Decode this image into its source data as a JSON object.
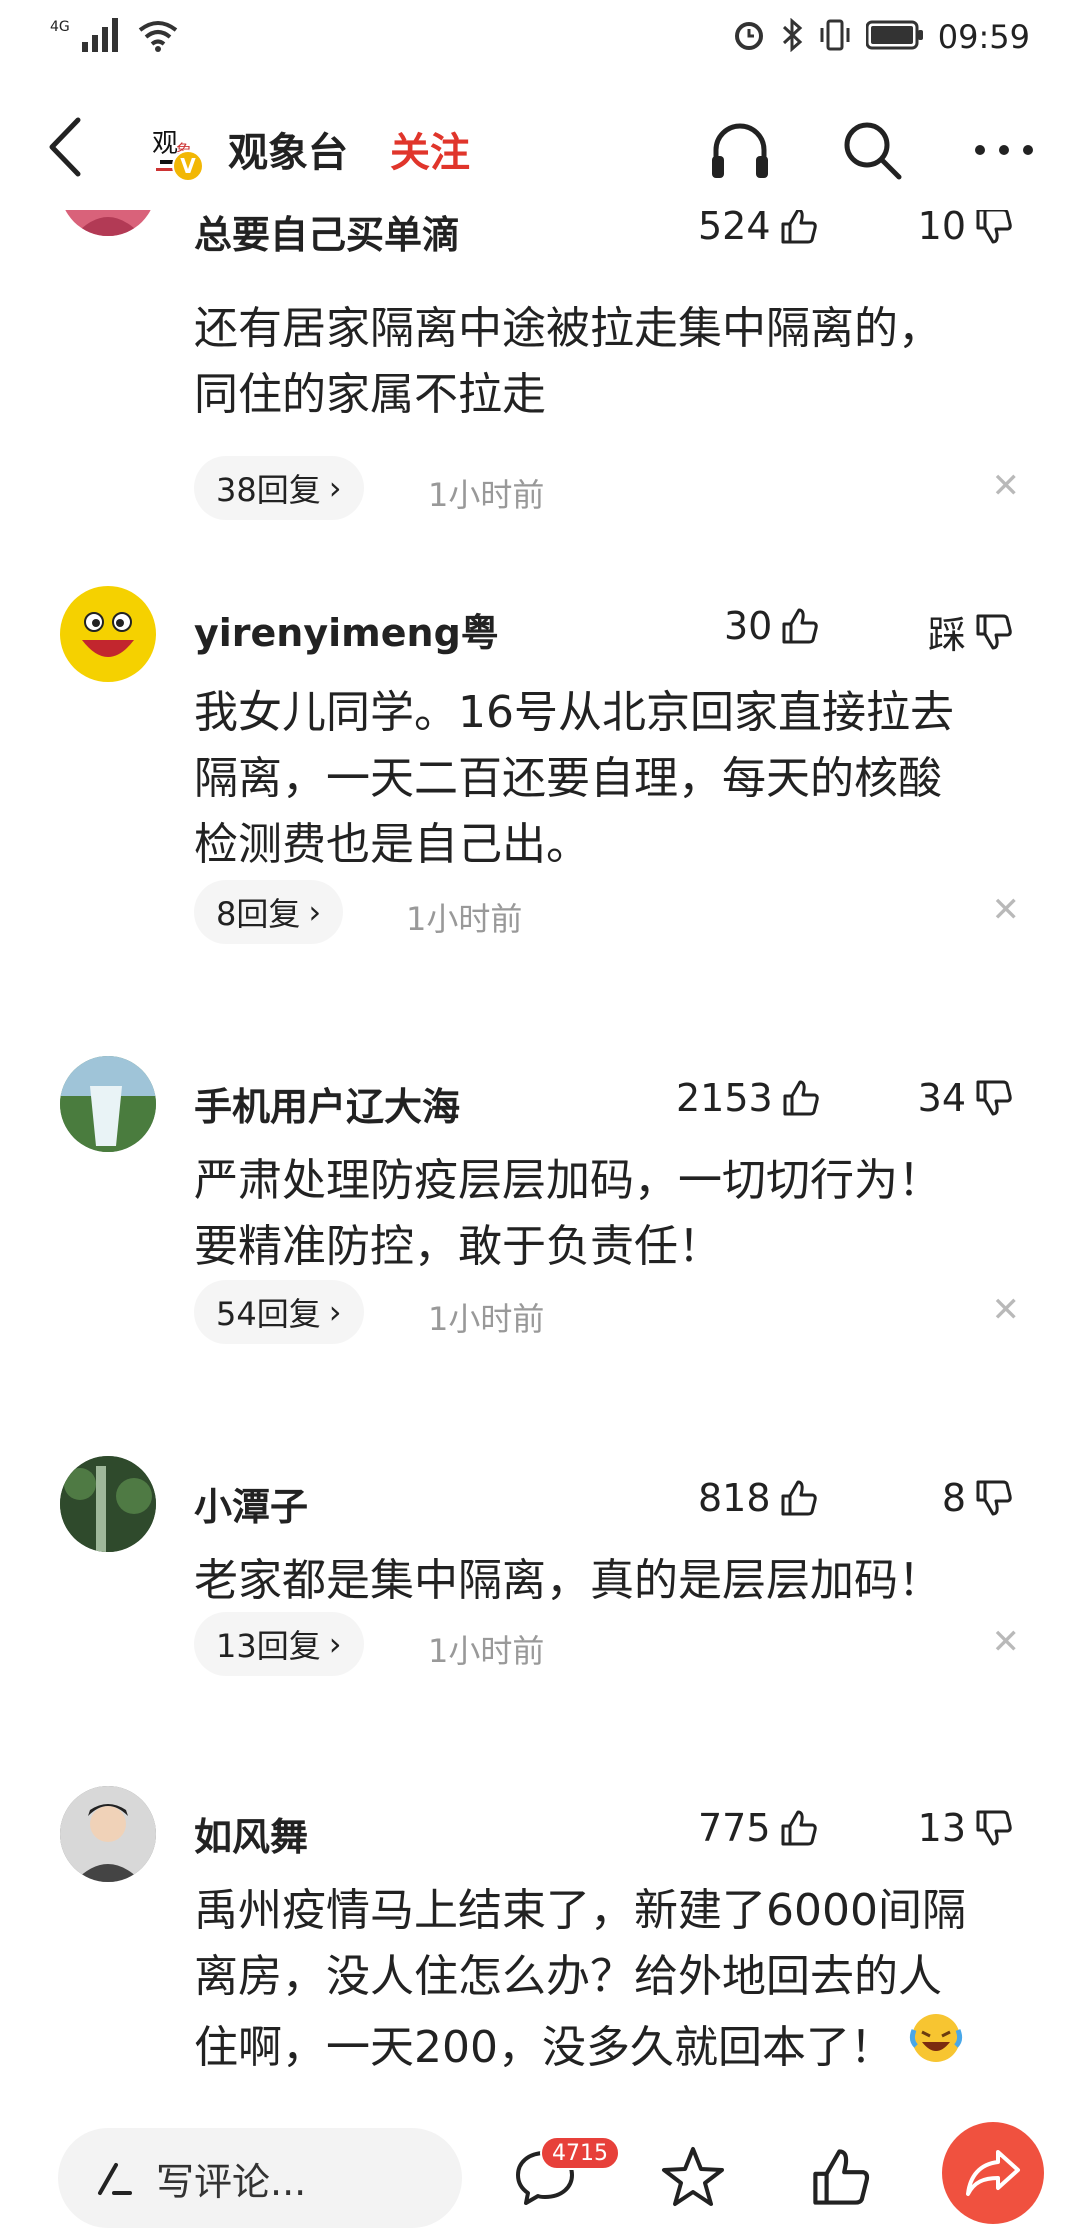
{
  "status_bar": {
    "network": "4G",
    "time": "09:59"
  },
  "header": {
    "channel_name": "观象台",
    "follow_label": "关注",
    "verified_badge": "V"
  },
  "comments": [
    {
      "name": "总要自己买单滴",
      "likes": "524",
      "dislikes": "10",
      "text_lines": [
        "还有居家隔离中途被拉走集中隔离的，",
        "同住的家属不拉走"
      ],
      "replies": "38回复",
      "time": "1小时前",
      "avatar_color": "#d9627a"
    },
    {
      "name": "yirenyimeng粤",
      "likes": "30",
      "dislikes": "踩",
      "text_lines": [
        "我女儿同学。16号从北京回家直接拉去",
        "隔离，一天二百还要自理，每天的核酸",
        "检测费也是自己出。"
      ],
      "replies": "8回复",
      "time": "1小时前",
      "avatar_color": "#f5d100"
    },
    {
      "name": "手机用户辽大海",
      "likes": "2153",
      "dislikes": "34",
      "text_lines": [
        "严肃处理防疫层层加码，一切切行为！",
        "要精准防控，敢于负责任！"
      ],
      "replies": "54回复",
      "time": "1小时前",
      "avatar_color": "#5e8a57"
    },
    {
      "name": "小潭子",
      "likes": "818",
      "dislikes": "8",
      "text_lines": [
        "老家都是集中隔离，真的是层层加码！"
      ],
      "replies": "13回复",
      "time": "1小时前",
      "avatar_color": "#3d5a3a"
    },
    {
      "name": "如风舞",
      "likes": "775",
      "dislikes": "13",
      "text_lines": [
        "禹州疫情马上结束了，新建了6000间隔",
        "离房，没人住怎么办？给外地回去的人",
        "住啊，一天200，没多久就回本了！"
      ],
      "avatar_color": "#6d6d6d"
    }
  ],
  "bottom_bar": {
    "input_placeholder": "写评论...",
    "comment_count": "4715"
  },
  "colors": {
    "accent_red": "#e0352b",
    "share_orange": "#f0513f",
    "muted_gray": "#999999"
  }
}
